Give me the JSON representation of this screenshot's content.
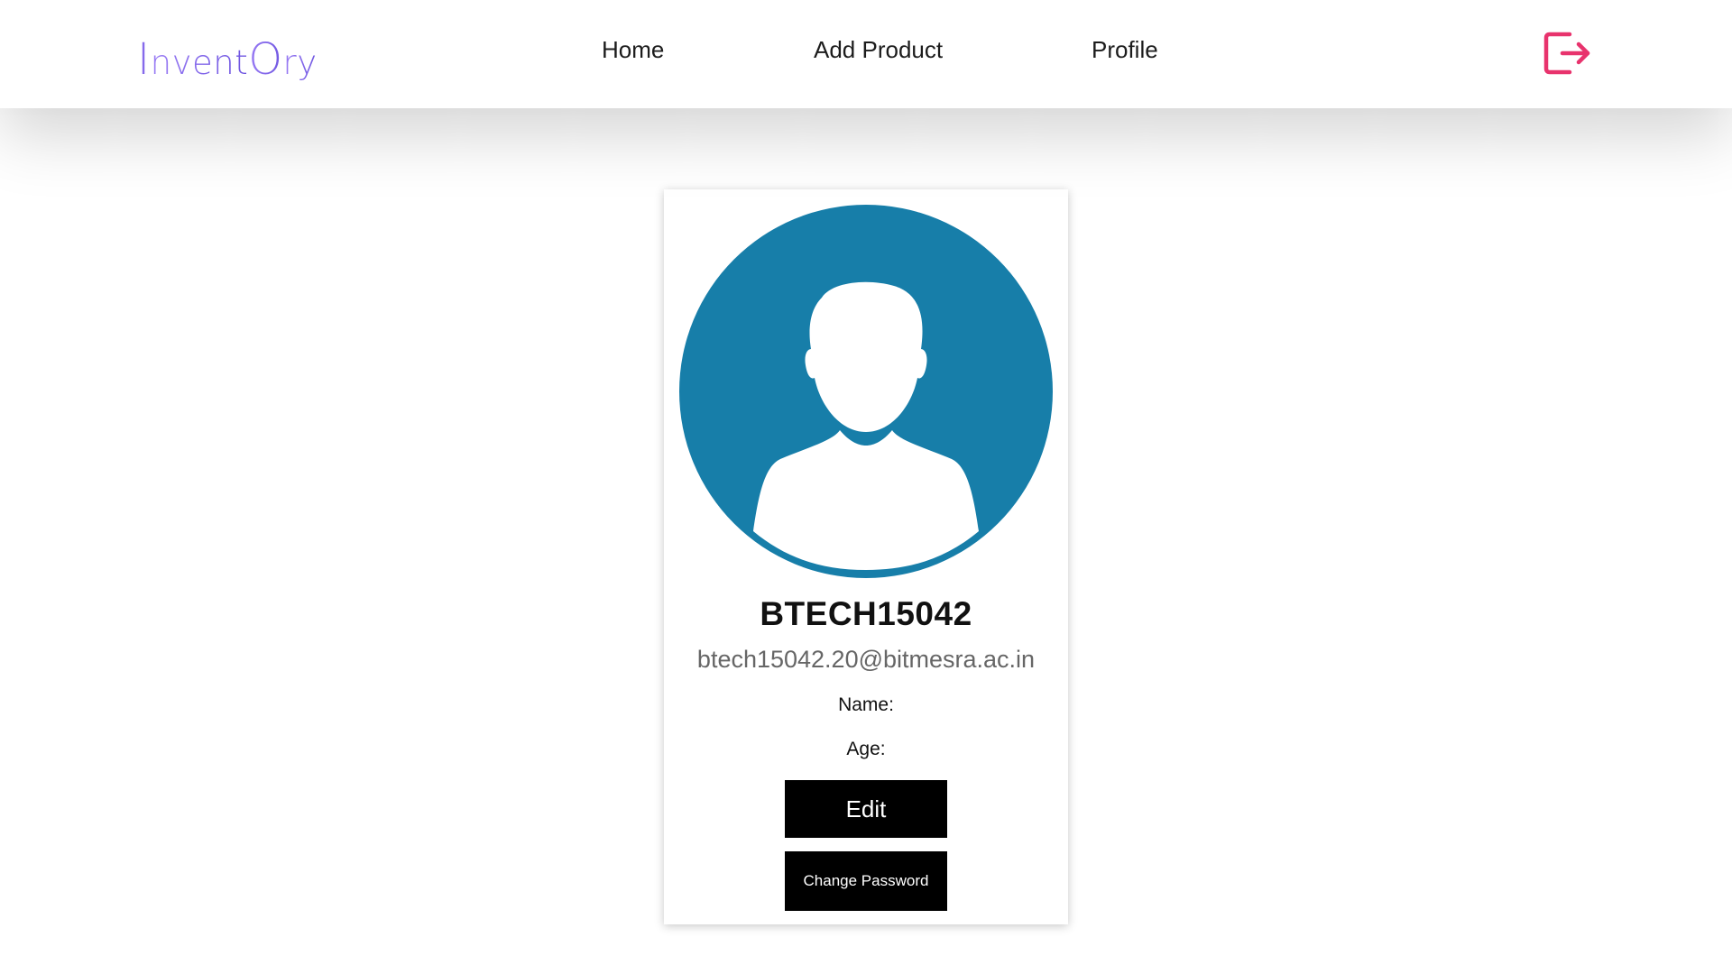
{
  "brand": {
    "logo_text": "InventOry",
    "logo_letters": [
      "I",
      "nvent",
      "O",
      "ry"
    ],
    "color": "#8a6cf0"
  },
  "nav": {
    "home": "Home",
    "add_product": "Add Product",
    "profile": "Profile",
    "logout_icon": "logout-arrow-icon",
    "logout_color": "#e8336d"
  },
  "profile": {
    "avatar_icon": "user-avatar-icon",
    "avatar_color": "#177ea9",
    "username": "BTECH15042",
    "email": "btech15042.20@bitmesra.ac.in",
    "name_label": "Name:",
    "age_label": "Age:",
    "edit_button": "Edit",
    "change_password_button": "Change Password"
  }
}
